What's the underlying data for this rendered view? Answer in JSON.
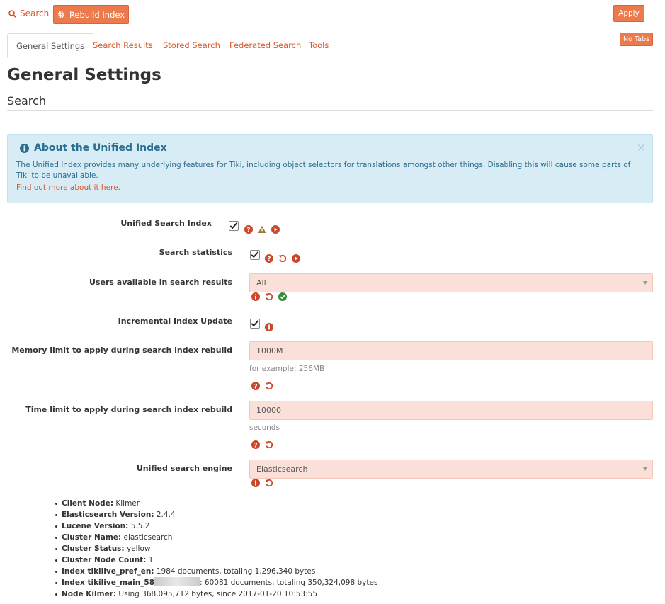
{
  "toolbar": {
    "search_label": "Search",
    "rebuild_label": "Rebuild Index",
    "apply_label": "Apply",
    "notabs_label": "No Tabs"
  },
  "tabs": [
    {
      "label": "General Settings",
      "active": true
    },
    {
      "label": "Search Results"
    },
    {
      "label": "Stored Search"
    },
    {
      "label": "Federated Search"
    },
    {
      "label": "Tools"
    }
  ],
  "page_title": "General Settings",
  "section_title": "Search",
  "alert": {
    "title": "About the Unified Index",
    "body": "The Unified Index provides many underlying features for Tiki, including object selectors for translations amongst other things. Disabling this will cause some parts of Tiki to be unavailable.",
    "link": "Find out more about it here.",
    "close": "×"
  },
  "settings": {
    "unified_index": {
      "label": "Unified Search Index",
      "checked": true
    },
    "stats": {
      "label": "Search statistics",
      "checked": true
    },
    "users": {
      "label": "Users available in search results",
      "value": "All"
    },
    "incremental": {
      "label": "Incremental Index Update",
      "checked": true
    },
    "memory": {
      "label": "Memory limit to apply during search index rebuild",
      "value": "1000M",
      "hint": "for example: 256MB"
    },
    "time": {
      "label": "Time limit to apply during search index rebuild",
      "value": "10000",
      "hint": "seconds"
    },
    "engine": {
      "label": "Unified search engine",
      "value": "Elasticsearch"
    }
  },
  "stats_list": [
    {
      "key": "Client Node:",
      "value": " Kilmer"
    },
    {
      "key": "Elasticsearch Version:",
      "value": " 2.4.4"
    },
    {
      "key": "Lucene Version:",
      "value": " 5.5.2"
    },
    {
      "key": "Cluster Name:",
      "value": " elasticsearch"
    },
    {
      "key": "Cluster Status:",
      "value": " yellow"
    },
    {
      "key": "Cluster Node Count:",
      "value": " 1"
    },
    {
      "key": "Index tikilive_pref_en:",
      "value": " 1984 documents, totaling 1,296,340 bytes"
    },
    {
      "key": "Index tikilive_main_58",
      "value": ": 60081 documents, totaling 350,324,098 bytes"
    },
    {
      "key": "Node Kilmer:",
      "value": " Using 368,095,712 bytes, since 2017-01-20 10:53:55"
    }
  ],
  "colors": {
    "accent": "#ec7a4c",
    "link": "#d9562a",
    "info_bg": "#d7ecf5",
    "field_bg": "#fae0d8"
  }
}
